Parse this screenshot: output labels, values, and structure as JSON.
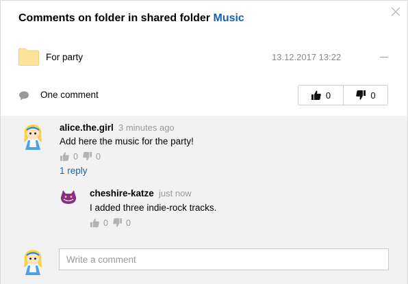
{
  "dialog": {
    "title_prefix": "Comments on folder in shared folder",
    "title_link": "Music"
  },
  "folder": {
    "name": "For party",
    "date": "13.12.2017 13:22",
    "icon": "folder-icon"
  },
  "summary": {
    "count_label": "One comment",
    "likes": "0",
    "dislikes": "0"
  },
  "comments": [
    {
      "author": "alice.the.girl",
      "time": "3 minutes ago",
      "text": "Add here the music for the party!",
      "likes": "0",
      "dislikes": "0",
      "reply_label": "1 reply",
      "replies": [
        {
          "author": "cheshire-katze",
          "time": "just now",
          "text": "I added three indie-rock tracks.",
          "likes": "0",
          "dislikes": "0"
        }
      ]
    }
  ],
  "composer": {
    "placeholder": "Write a comment"
  },
  "colors": {
    "link": "#1a5fb4",
    "folder": "#fbe39a",
    "panel": "#f2f2f2"
  }
}
